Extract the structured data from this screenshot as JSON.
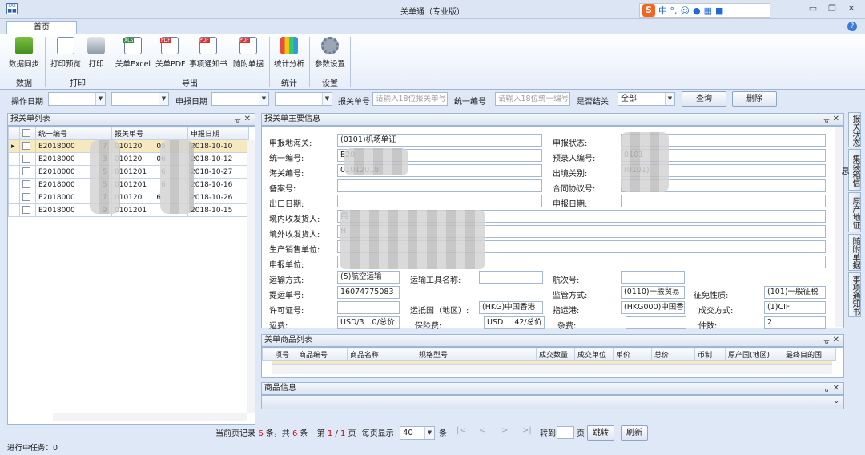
{
  "window": {
    "title": "关单通（专业版）",
    "ime": "中 °,",
    "icon": "app-icon"
  },
  "tabs": {
    "home": "首页"
  },
  "ribbon": {
    "buttons": [
      {
        "label": "数据同步",
        "icon": "download-icon"
      },
      {
        "label": "打印预览",
        "icon": "print-preview-icon"
      },
      {
        "label": "打印",
        "icon": "printer-icon"
      },
      {
        "label": "关单Excel",
        "icon": "excel-icon"
      },
      {
        "label": "关单PDF",
        "icon": "pdf-icon"
      },
      {
        "label": "事项通知书",
        "icon": "pdf-notice-icon"
      },
      {
        "label": "随附单据",
        "icon": "pdf-attach-icon"
      },
      {
        "label": "统计分析",
        "icon": "chart-icon"
      },
      {
        "label": "参数设置",
        "icon": "gear-icon"
      }
    ],
    "groups": {
      "data": "数据",
      "print": "打印",
      "export": "导出",
      "stats": "统计",
      "settings": "设置"
    }
  },
  "filter": {
    "op_date": "操作日期",
    "decl_date": "申报日期",
    "decl_no": "报关单号",
    "decl_no_ph": "请输入18位报关单号",
    "unified_no": "统一编号",
    "unified_no_ph": "请输入18位统一编号",
    "closed": "是否结关",
    "closed_val": "全部",
    "query": "查询",
    "delete": "删除"
  },
  "list": {
    "title": "报关单列表",
    "columns": [
      "统一编号",
      "报关单号",
      "申报日期"
    ],
    "rows": [
      {
        "uid": "E2018000",
        "uid2": "7",
        "dno": "010120",
        "dno2": "05",
        "date": "2018-10-10"
      },
      {
        "uid": "E2018000",
        "uid2": "3",
        "dno": "010120",
        "dno2": "06",
        "date": "2018-10-12"
      },
      {
        "uid": "E2018000",
        "uid2": "5",
        "dno": "0101201",
        "dno2": "6",
        "date": "2018-10-27"
      },
      {
        "uid": "E2018000",
        "uid2": "5",
        "dno": "0101201",
        "dno2": "6",
        "date": "2018-10-16"
      },
      {
        "uid": "E2018000",
        "uid2": "7",
        "dno": "010120",
        "dno2": "6",
        "date": "2018-10-26"
      },
      {
        "uid": "E2018000",
        "uid2": "9",
        "dno": "0101201",
        "dno2": "",
        "date": "2018-10-15"
      }
    ]
  },
  "main": {
    "title": "报关单主要信息",
    "fields": {
      "port_lbl": "申报地海关:",
      "port": "(0101)机场单证",
      "status_lbl": "申报状态:",
      "uid_lbl": "统一编号:",
      "uid": "E20",
      "pre_lbl": "预录入编号:",
      "pre": "0101",
      "customs_lbl": "海关编号:",
      "customs": "01012018",
      "exit_lbl": "出境关别:",
      "exit": "(0101)",
      "record_lbl": "备案号:",
      "contract_lbl": "合同协议号:",
      "export_date_lbl": "出口日期:",
      "decl_date_lbl": "申报日期:",
      "consignee_lbl": "境内收发货人:",
      "consignee": "南",
      "foreign_lbl": "境外收发货人:",
      "foreign": "H",
      "producer_lbl": "生产销售单位:",
      "declarant_lbl": "申报单位:",
      "transport_lbl": "运输方式:",
      "transport": "(5)航空运输",
      "tool_lbl": "运输工具名称:",
      "voyage_lbl": "航次号:",
      "bill_lbl": "提运单号:",
      "bill": "16074775083",
      "supervise_lbl": "监管方式:",
      "supervise": "(0110)一般贸易",
      "tax_lbl": "征免性质:",
      "tax": "(101)一般征税",
      "license_lbl": "许可证号:",
      "country_lbl": "运抵国（地区）:",
      "country": "(HKG)中国香港",
      "dest_port_lbl": "指运港:",
      "dest_port": "(HKG000)中国香港",
      "deal_lbl": "成交方式:",
      "deal": "(1)CIF",
      "freight_lbl": "运费:",
      "freight": "USD/3",
      "freight2": "0/总价",
      "insurance_lbl": "保险费:",
      "insurance": "USD",
      "insurance2": "42/总价",
      "misc_lbl": "杂费:",
      "pieces_lbl": "件数:",
      "pieces": "2"
    }
  },
  "goods": {
    "title": "关单商品列表",
    "columns": [
      "项号",
      "商品编号",
      "商品名称",
      "规格型号",
      "成交数量",
      "成交单位",
      "单价",
      "总价",
      "币制",
      "原产国(地区)",
      "最终目的国"
    ]
  },
  "goods_info": {
    "title": "商品信息"
  },
  "side_tabs": [
    "报关状态",
    "集装箱信息",
    "原产地证",
    "随附单据",
    "事项通知书"
  ],
  "pager": {
    "current": "当前页记录",
    "cur_count": "6",
    "unit": "条，共",
    "total": "6",
    "unit2": "条",
    "page_pre": "第",
    "page": "1",
    "slash": "/",
    "pages": "1",
    "page_suf": "页",
    "per_page": "每页显示",
    "per_page_val": "40",
    "per_unit": "条",
    "goto": "转到",
    "page_lbl": "页",
    "jump": "跳转",
    "refresh": "刷新"
  },
  "status": "进行中任务：0"
}
